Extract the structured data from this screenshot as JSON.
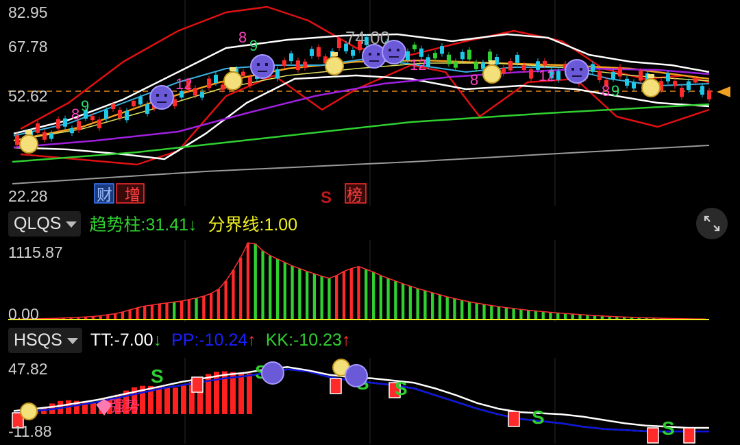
{
  "main": {
    "ytick_top": "82.95",
    "ytick_mid1": "67.78",
    "ytick_mid2": "52.62",
    "ytick_bottom": "22.28",
    "badge_cai": "财",
    "badge_zeng": "增",
    "badge_s": "S",
    "badge_bang": "榜",
    "float_price": "74.00",
    "counts": [
      "8",
      "9",
      "12",
      "8",
      "9",
      "12",
      "8",
      "12",
      "8",
      "9"
    ],
    "colors": {
      "up": "#ff2a2a",
      "down": "#1ec8e8",
      "ma_white": "#ffffff",
      "ma_orange": "#f0a020",
      "ma_purple": "#a020e0",
      "ma_green": "#30d030",
      "ma_gray": "#9a9a9a",
      "band_red": "#e01010"
    }
  },
  "qlqs": {
    "selector": "QLQS",
    "trend_label": "趋势柱:",
    "trend_value": "31.41",
    "trend_arrow": "↓",
    "boundary_label": "分界线:",
    "boundary_value": "1.00",
    "ytick_top": "1115.87",
    "ytick_bottom": "0.00",
    "colors": {
      "trend": "#30d030",
      "boundary": "#f0f020"
    }
  },
  "hsqs": {
    "selector": "HSQS",
    "tt_label": "TT:",
    "tt_value": "-7.00",
    "tt_arrow": "↓",
    "pp_label": "PP:",
    "pp_value": "-10.24",
    "pp_arrow": "↑",
    "kk_label": "KK:",
    "kk_value": "-10.23",
    "kk_arrow": "↑",
    "ytick_top": "47.82",
    "ytick_bottom": "-11.88",
    "signal_qiang": "强势",
    "signal_s": "S",
    "colors": {
      "tt": "#ffffff",
      "pp": "#1010e0",
      "kk": "#30d030"
    }
  },
  "chart_data": [
    {
      "type": "bar",
      "title": "QLQS",
      "ylim": [
        0,
        1115.87
      ],
      "series": [
        {
          "name": "趋势柱",
          "values": [
            4,
            6,
            8,
            10,
            12,
            15,
            18,
            22,
            28,
            32,
            38,
            45,
            55,
            70,
            85,
            110,
            140,
            170,
            195,
            210,
            228,
            240,
            255,
            268,
            290,
            312,
            340,
            380,
            440,
            560,
            720,
            900,
            1115,
            1100,
            1000,
            930,
            880,
            830,
            780,
            740,
            700,
            665,
            630,
            600,
            640,
            700,
            740,
            770,
            730,
            690,
            640,
            600,
            560,
            520,
            485,
            450,
            420,
            390,
            360,
            330,
            305,
            280,
            258,
            238,
            220,
            203,
            188,
            173,
            160,
            147,
            135,
            125,
            115,
            105,
            96,
            88,
            80,
            72,
            65,
            58,
            52,
            46,
            41,
            36,
            32,
            28,
            25,
            22,
            19,
            16,
            14,
            12,
            10,
            9,
            8
          ],
          "colors": [
            "r",
            "r",
            "r",
            "r",
            "r",
            "r",
            "r",
            "r",
            "r",
            "r",
            "r",
            "r",
            "r",
            "r",
            "r",
            "r",
            "r",
            "r",
            "r",
            "r",
            "r",
            "r",
            "g",
            "r",
            "r",
            "g",
            "r",
            "r",
            "r",
            "r",
            "r",
            "r",
            "r",
            "g",
            "g",
            "g",
            "g",
            "g",
            "g",
            "g",
            "g",
            "g",
            "g",
            "g",
            "r",
            "r",
            "r",
            "r",
            "g",
            "g",
            "g",
            "g",
            "g",
            "g",
            "g",
            "g",
            "g",
            "g",
            "g",
            "g",
            "g",
            "g",
            "g",
            "g",
            "g",
            "g",
            "g",
            "g",
            "g",
            "g",
            "g",
            "g",
            "g",
            "g",
            "g",
            "g",
            "g",
            "g",
            "g",
            "g",
            "g",
            "g",
            "g",
            "g",
            "g",
            "g",
            "g",
            "g",
            "g",
            "g",
            "g",
            "g",
            "g",
            "g",
            "g"
          ]
        },
        {
          "name": "分界线",
          "values": [
            1.0
          ]
        }
      ]
    },
    {
      "type": "line",
      "title": "HSQS",
      "ylim": [
        -11.88,
        47.82
      ],
      "series": [
        {
          "name": "TT",
          "values": [
            8,
            10,
            12,
            15,
            18,
            22,
            26,
            30,
            34,
            37,
            40,
            42,
            45,
            47,
            44,
            40,
            38,
            37,
            35,
            33,
            28,
            22,
            15,
            10,
            7,
            6,
            5,
            3,
            0,
            -3,
            -5,
            -6,
            -7,
            -7
          ]
        },
        {
          "name": "PP",
          "values": [
            6,
            8,
            10,
            13,
            16,
            20,
            24,
            28,
            31,
            34,
            37,
            39,
            42,
            45,
            43,
            38,
            35,
            33,
            31,
            28,
            22,
            16,
            10,
            5,
            1,
            -1,
            -3,
            -6,
            -8,
            -9,
            -10,
            -10.2,
            -10.24,
            -10.24
          ]
        },
        {
          "name": "KK",
          "values": [
            6,
            8,
            10,
            13,
            16,
            20,
            24,
            28,
            31,
            34,
            37,
            39,
            42,
            45,
            43,
            38,
            35,
            33,
            31,
            28,
            22,
            16,
            10,
            5,
            1,
            -1,
            -3,
            -6,
            -8,
            -9,
            -10,
            -10.2,
            -10.23,
            -10.23
          ]
        }
      ]
    }
  ]
}
